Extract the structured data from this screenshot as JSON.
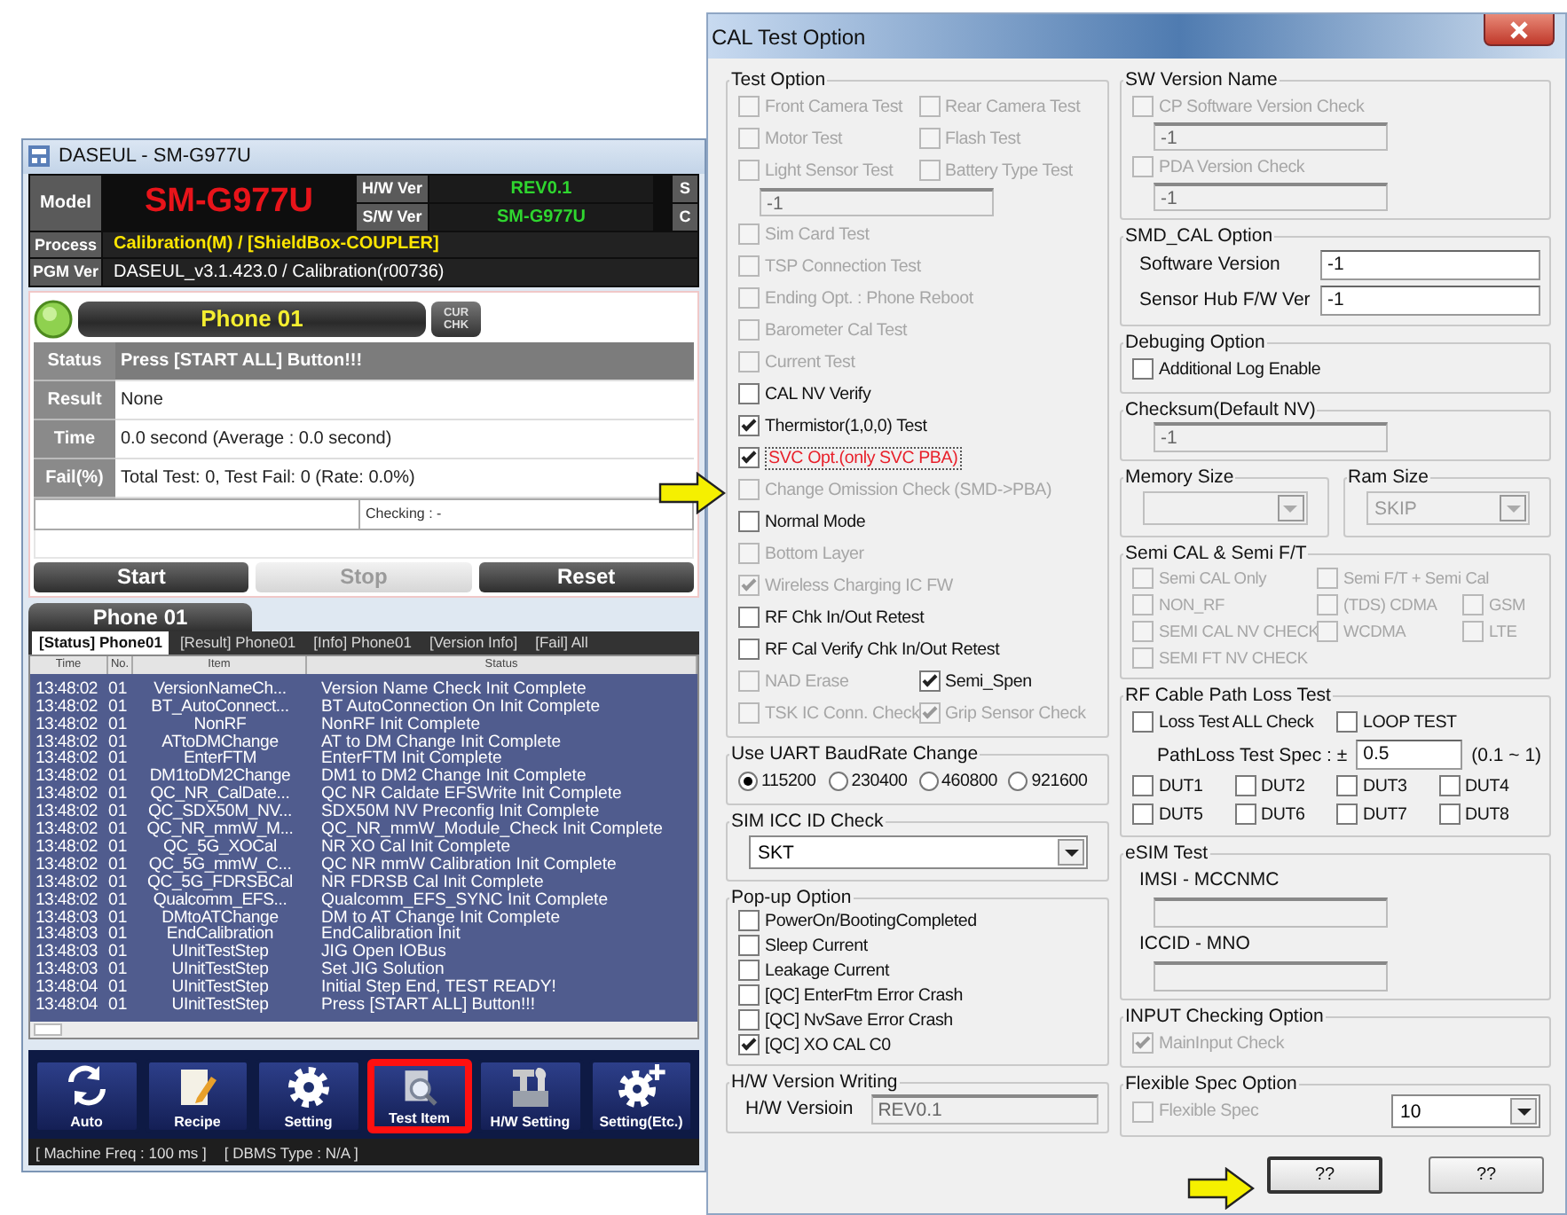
{
  "app_window": {
    "title": "DASEUL - SM-G977U",
    "header": {
      "model_label": "Model",
      "model": "SM-G977U",
      "hw_label": "H/W Ver",
      "hw_value": "REV0.1",
      "sw_label": "S/W Ver",
      "sw_value": "SM-G977U",
      "cut_labels": [
        "S",
        "C"
      ],
      "process_label": "Process",
      "process": "Calibration(M) / [ShieldBox-COUPLER]",
      "pgm_label": "PGM Ver",
      "pgm": "DASEUL_v3.1.423.0 / Calibration(r00736)"
    },
    "phone": {
      "name": "Phone 01",
      "check_button": "CUR CHK",
      "rows": [
        {
          "label": "Status",
          "value": "Press [START ALL] Button!!!",
          "highlighted": true
        },
        {
          "label": "Result",
          "value": "None",
          "highlighted": false
        },
        {
          "label": "Time",
          "value": "0.0 second (Average : 0.0 second)",
          "highlighted": false
        },
        {
          "label": "Fail(%)",
          "value": "Total Test: 0, Test Fail: 0 (Rate: 0.0%)",
          "highlighted": false
        }
      ],
      "checking": "Checking : -",
      "buttons": [
        {
          "label": "Start",
          "disabled": false
        },
        {
          "label": "Stop",
          "disabled": true
        },
        {
          "label": "Reset",
          "disabled": false
        }
      ]
    },
    "log": {
      "title": "Phone 01",
      "tabs": [
        {
          "label": "[Status] Phone01",
          "selected": true
        },
        {
          "label": "[Result] Phone01",
          "selected": false
        },
        {
          "label": "[Info] Phone01",
          "selected": false
        },
        {
          "label": "[Version Info]",
          "selected": false
        },
        {
          "label": "[Fail] All",
          "selected": false
        }
      ],
      "columns": [
        "Time",
        "No.",
        "Item",
        "Status"
      ],
      "rows": [
        [
          "13:48:02",
          "01",
          "VersionNameCh...",
          "Version Name Check Init Complete"
        ],
        [
          "13:48:02",
          "01",
          "BT_AutoConnect...",
          "BT AutoConnection On Init Complete"
        ],
        [
          "13:48:02",
          "01",
          "NonRF",
          "NonRF Init Complete"
        ],
        [
          "13:48:02",
          "01",
          "ATtoDMChange",
          "AT to DM Change Init Complete"
        ],
        [
          "13:48:02",
          "01",
          "EnterFTM",
          "EnterFTM Init Complete"
        ],
        [
          "13:48:02",
          "01",
          "DM1toDM2Change",
          "DM1 to DM2 Change Init Complete"
        ],
        [
          "13:48:02",
          "01",
          "QC_NR_CalDate...",
          "QC NR Caldate EFSWrite Init Complete"
        ],
        [
          "13:48:02",
          "01",
          "QC_SDX50M_NV...",
          "SDX50M NV Preconfig Init Complete"
        ],
        [
          "13:48:02",
          "01",
          "QC_NR_mmW_M...",
          "QC_NR_mmW_Module_Check Init Complete"
        ],
        [
          "13:48:02",
          "01",
          "QC_5G_XOCal",
          "NR XO Cal Init Complete"
        ],
        [
          "13:48:02",
          "01",
          "QC_5G_mmW_C...",
          "QC NR mmW Calibration Init Complete"
        ],
        [
          "13:48:02",
          "01",
          "QC_5G_FDRSBCal",
          "NR FDRSB Cal Init Complete"
        ],
        [
          "13:48:02",
          "01",
          "Qualcomm_EFS...",
          "Qualcomm_EFS_SYNC Init Complete"
        ],
        [
          "13:48:03",
          "01",
          "DMtoATChange",
          "DM to AT Change Init Complete"
        ],
        [
          "13:48:03",
          "01",
          "EndCalibration",
          "EndCalibration Init"
        ],
        [
          "13:48:03",
          "01",
          "UInitTestStep",
          "JIG Open IOBus"
        ],
        [
          "13:48:03",
          "01",
          "UInitTestStep",
          "Set JIG Solution"
        ],
        [
          "13:48:04",
          "01",
          "UInitTestStep",
          "Initial Step End, TEST READY!"
        ],
        [
          "13:48:04",
          "01",
          "UInitTestStep",
          "Press [START ALL] Button!!!"
        ]
      ]
    },
    "toolbar": [
      {
        "label": "Auto",
        "highlighted": false
      },
      {
        "label": "Recipe",
        "highlighted": false
      },
      {
        "label": "Setting",
        "highlighted": false
      },
      {
        "label": "Test Item",
        "highlighted": true
      },
      {
        "label": "H/W Setting",
        "highlighted": false
      },
      {
        "label": "Setting(Etc.)",
        "highlighted": false
      }
    ],
    "status_bar": [
      "[ Machine Freq : 100 ms ]",
      "[ DBMS Type : N/A ]"
    ]
  },
  "dialog": {
    "title": "CAL Test Option",
    "left_column": [
      {
        "kind": "group",
        "title": "Test Option",
        "rows": [
          {
            "cells": [
              {
                "kind": "checkbox",
                "label": "Front Camera Test",
                "checked": false,
                "disabled": true,
                "focused": false
              },
              {
                "kind": "checkbox",
                "label": "Rear Camera Test",
                "checked": false,
                "disabled": true,
                "focused": false
              }
            ]
          },
          {
            "cells": [
              {
                "kind": "checkbox",
                "label": "Motor Test",
                "checked": false,
                "disabled": true,
                "focused": false
              },
              {
                "kind": "checkbox",
                "label": "Flash Test",
                "checked": false,
                "disabled": true,
                "focused": false
              }
            ]
          },
          {
            "cells": [
              {
                "kind": "checkbox",
                "label": "Light Sensor Test",
                "checked": false,
                "disabled": true,
                "focused": false
              },
              {
                "kind": "checkbox",
                "label": "Battery Type Test",
                "checked": false,
                "disabled": true,
                "focused": false
              }
            ]
          },
          {
            "cells": [
              {
                "kind": "field",
                "value": "-1",
                "disabled": true
              }
            ]
          },
          {
            "cells": [
              {
                "kind": "checkbox",
                "label": "Sim Card Test",
                "checked": false,
                "disabled": true,
                "focused": false
              }
            ]
          },
          {
            "cells": [
              {
                "kind": "checkbox",
                "label": "TSP Connection Test",
                "checked": false,
                "disabled": true,
                "focused": false
              }
            ]
          },
          {
            "cells": [
              {
                "kind": "checkbox",
                "label": "Ending Opt. : Phone Reboot",
                "checked": false,
                "disabled": true,
                "focused": false
              }
            ]
          },
          {
            "cells": [
              {
                "kind": "checkbox",
                "label": "Barometer Cal Test",
                "checked": false,
                "disabled": true,
                "focused": false
              }
            ]
          },
          {
            "cells": [
              {
                "kind": "checkbox",
                "label": "Current Test",
                "checked": false,
                "disabled": true,
                "focused": false
              }
            ]
          },
          {
            "cells": [
              {
                "kind": "checkbox",
                "label": "CAL NV Verify",
                "checked": false,
                "disabled": false,
                "focused": false
              }
            ]
          },
          {
            "cells": [
              {
                "kind": "checkbox",
                "label": "Thermistor(1,0,0) Test",
                "checked": true,
                "disabled": false,
                "focused": false
              }
            ]
          },
          {
            "cells": [
              {
                "kind": "checkbox",
                "label": "SVC Opt.(only SVC PBA)",
                "checked": true,
                "disabled": false,
                "focused": true
              }
            ]
          },
          {
            "cells": [
              {
                "kind": "checkbox",
                "label": "Change Omission Check (SMD->PBA)",
                "checked": false,
                "disabled": true,
                "focused": false
              }
            ]
          },
          {
            "cells": [
              {
                "kind": "checkbox",
                "label": "Normal Mode",
                "checked": false,
                "disabled": false,
                "focused": false
              }
            ]
          },
          {
            "cells": [
              {
                "kind": "checkbox",
                "label": "Bottom Layer",
                "checked": false,
                "disabled": true,
                "focused": false
              }
            ]
          },
          {
            "cells": [
              {
                "kind": "checkbox",
                "label": "Wireless Charging IC FW",
                "checked": true,
                "disabled": true,
                "focused": false
              }
            ]
          },
          {
            "cells": [
              {
                "kind": "checkbox",
                "label": "RF Chk In/Out Retest",
                "checked": false,
                "disabled": false,
                "focused": false
              }
            ]
          },
          {
            "cells": [
              {
                "kind": "checkbox",
                "label": "RF Cal Verify Chk In/Out Retest",
                "checked": false,
                "disabled": false,
                "focused": false
              }
            ]
          },
          {
            "cells": [
              {
                "kind": "checkbox",
                "label": "NAD Erase",
                "checked": false,
                "disabled": true,
                "focused": false
              },
              {
                "kind": "checkbox",
                "label": "Semi_Spen",
                "checked": true,
                "disabled": false,
                "focused": false
              }
            ]
          },
          {
            "cells": [
              {
                "kind": "checkbox",
                "label": "TSK IC Conn. Check",
                "checked": false,
                "disabled": true,
                "focused": false
              },
              {
                "kind": "checkbox",
                "label": "Grip Sensor Check",
                "checked": true,
                "disabled": true,
                "focused": false
              }
            ]
          }
        ]
      },
      {
        "kind": "group",
        "title": "Use UART BaudRate Change",
        "rows": [
          {
            "cells": [
              {
                "kind": "radio",
                "label": "115200",
                "selected": true
              },
              {
                "kind": "radio",
                "label": "230400",
                "selected": false
              },
              {
                "kind": "radio",
                "label": "460800",
                "selected": false
              },
              {
                "kind": "radio",
                "label": "921600",
                "selected": false
              }
            ]
          }
        ]
      },
      {
        "kind": "group",
        "title": "SIM ICC ID Check",
        "rows": [
          {
            "cells": [
              {
                "kind": "select",
                "value": "SKT",
                "disabled": false
              }
            ]
          }
        ]
      },
      {
        "kind": "group",
        "title": "Pop-up Option",
        "rows": [
          {
            "cells": [
              {
                "kind": "checkbox",
                "label": "PowerOn/BootingCompleted",
                "checked": false,
                "disabled": false
              }
            ]
          },
          {
            "cells": [
              {
                "kind": "checkbox",
                "label": "Sleep Current",
                "checked": false,
                "disabled": false
              }
            ]
          },
          {
            "cells": [
              {
                "kind": "checkbox",
                "label": "Leakage Current",
                "checked": false,
                "disabled": false
              }
            ]
          },
          {
            "cells": [
              {
                "kind": "checkbox",
                "label": "[QC] EnterFtm Error Crash",
                "checked": false,
                "disabled": false
              }
            ]
          },
          {
            "cells": [
              {
                "kind": "checkbox",
                "label": "[QC] NvSave Error Crash",
                "checked": false,
                "disabled": false
              }
            ]
          },
          {
            "cells": [
              {
                "kind": "checkbox",
                "label": "[QC] XO CAL C0",
                "checked": true,
                "disabled": false
              }
            ]
          }
        ]
      },
      {
        "kind": "group",
        "title": "H/W Version Writing",
        "rows": [
          {
            "cells": [
              {
                "kind": "label",
                "text": "H/W Versioin"
              },
              {
                "kind": "field",
                "value": "REV0.1",
                "disabled": true
              }
            ]
          }
        ]
      }
    ],
    "right_column": [
      {
        "kind": "group",
        "title": "SW Version Name",
        "rows": [
          {
            "cells": [
              {
                "kind": "checkbox",
                "label": "CP Software Version Check",
                "checked": false,
                "disabled": true
              }
            ]
          },
          {
            "cells": [
              {
                "kind": "field",
                "value": "-1",
                "disabled": true
              }
            ]
          },
          {
            "cells": [
              {
                "kind": "checkbox",
                "label": "PDA Version Check",
                "checked": false,
                "disabled": true
              }
            ]
          },
          {
            "cells": [
              {
                "kind": "field",
                "value": "-1",
                "disabled": true
              }
            ]
          }
        ]
      },
      {
        "kind": "group",
        "title": "SMD_CAL Option",
        "rows": [
          {
            "cells": [
              {
                "kind": "label",
                "text": "Software Version"
              },
              {
                "kind": "field",
                "value": "-1",
                "disabled": false
              }
            ]
          },
          {
            "cells": [
              {
                "kind": "label",
                "text": "Sensor Hub F/W Ver"
              },
              {
                "kind": "field",
                "value": "-1",
                "disabled": false
              }
            ]
          }
        ]
      },
      {
        "kind": "group",
        "title": "Debuging Option",
        "rows": [
          {
            "cells": [
              {
                "kind": "checkbox",
                "label": "Additional Log Enable",
                "checked": false,
                "disabled": false
              }
            ]
          }
        ]
      },
      {
        "kind": "group",
        "title": "Checksum(Default NV)",
        "rows": [
          {
            "cells": [
              {
                "kind": "field",
                "value": "-1",
                "disabled": true
              }
            ]
          }
        ]
      },
      {
        "kind": "pair",
        "groups": [
          {
            "title": "Memory Size",
            "rows": [
              {
                "cells": [
                  {
                    "kind": "select",
                    "disabled": true
                  }
                ]
              }
            ]
          },
          {
            "title": "Ram Size",
            "rows": [
              {
                "cells": [
                  {
                    "kind": "select",
                    "value": "SKIP",
                    "disabled": true
                  }
                ]
              }
            ]
          }
        ]
      },
      {
        "kind": "group",
        "title": "Semi CAL & Semi F/T",
        "rows": [
          {
            "cells": [
              {
                "kind": "checkbox",
                "label": "Semi CAL Only",
                "checked": false,
                "disabled": true
              },
              {
                "kind": "checkbox",
                "label": "Semi F/T + Semi Cal",
                "checked": false,
                "disabled": true
              }
            ]
          },
          {
            "cells": [
              {
                "kind": "checkbox",
                "label": "NON_RF",
                "checked": false,
                "disabled": true
              },
              {
                "kind": "checkbox",
                "label": "(TDS) CDMA",
                "checked": false,
                "disabled": true
              },
              {
                "kind": "checkbox",
                "label": "GSM",
                "checked": false,
                "disabled": true
              }
            ]
          },
          {
            "cells": [
              {
                "kind": "checkbox",
                "label": "SEMI CAL NV CHECK",
                "checked": false,
                "disabled": true
              },
              {
                "kind": "checkbox",
                "label": "WCDMA",
                "checked": false,
                "disabled": true
              },
              {
                "kind": "checkbox",
                "label": "LTE",
                "checked": false,
                "disabled": true
              }
            ]
          },
          {
            "cells": [
              {
                "kind": "checkbox",
                "label": "SEMI FT NV CHECK",
                "checked": false,
                "disabled": true
              }
            ]
          }
        ]
      },
      {
        "kind": "group",
        "title": "RF Cable Path Loss Test",
        "rows": [
          {
            "cells": [
              {
                "kind": "checkbox",
                "label": "Loss Test ALL Check",
                "checked": false,
                "disabled": false
              },
              {
                "kind": "checkbox",
                "label": "LOOP TEST",
                "checked": false,
                "disabled": false
              }
            ]
          },
          {
            "cells": [
              {
                "kind": "spec",
                "label": "PathLoss Test Spec : ±",
                "value": "0.5",
                "range": "(0.1 ~ 1)"
              }
            ]
          }
        ],
        "dut_rows": [
          {
            "cells": [
              {
                "kind": "checkbox",
                "label": "DUT1",
                "checked": false,
                "disabled": false
              },
              {
                "kind": "checkbox",
                "label": "DUT2",
                "checked": false,
                "disabled": false
              },
              {
                "kind": "checkbox",
                "label": "DUT3",
                "checked": false,
                "disabled": false
              },
              {
                "kind": "checkbox",
                "label": "DUT4",
                "checked": false,
                "disabled": false
              }
            ]
          },
          {
            "cells": [
              {
                "kind": "checkbox",
                "label": "DUT5",
                "checked": false,
                "disabled": false
              },
              {
                "kind": "checkbox",
                "label": "DUT6",
                "checked": false,
                "disabled": false
              },
              {
                "kind": "checkbox",
                "label": "DUT7",
                "checked": false,
                "disabled": false
              },
              {
                "kind": "checkbox",
                "label": "DUT8",
                "checked": false,
                "disabled": false
              }
            ]
          }
        ]
      },
      {
        "kind": "group",
        "title": "eSIM Test",
        "rows": [
          {
            "cells": [
              {
                "kind": "label",
                "text": "IMSI - MCCNMC"
              }
            ]
          },
          {
            "cells": [
              {
                "kind": "field",
                "disabled": true
              }
            ]
          },
          {
            "cells": [
              {
                "kind": "label",
                "text": "ICCID - MNO"
              }
            ]
          },
          {
            "cells": [
              {
                "kind": "field",
                "disabled": true
              }
            ]
          }
        ]
      },
      {
        "kind": "group",
        "title": "INPUT Checking Option",
        "rows": [
          {
            "cells": [
              {
                "kind": "checkbox",
                "label": "MainInput Check",
                "checked": true,
                "disabled": true
              }
            ]
          }
        ]
      },
      {
        "kind": "group",
        "title": "Flexible Spec Option",
        "rows": [
          {
            "cells": [
              {
                "kind": "checkbox",
                "label": "Flexible Spec",
                "checked": false,
                "disabled": true
              },
              {
                "kind": "select",
                "value": "10",
                "disabled": false
              }
            ]
          }
        ]
      }
    ],
    "buttons": [
      "??",
      "??"
    ]
  }
}
